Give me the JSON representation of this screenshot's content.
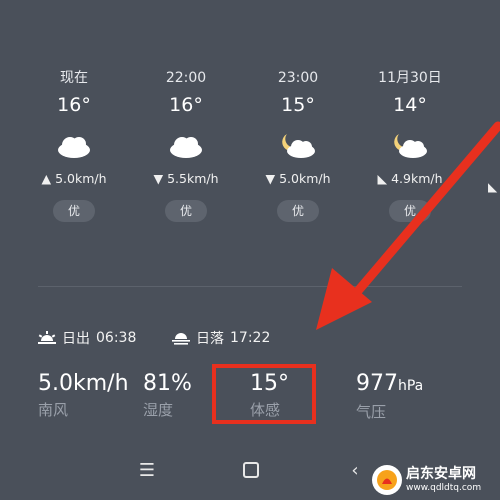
{
  "hourly": [
    {
      "time": "现在",
      "temp": "16°",
      "weather_icon": "cloudy-icon",
      "wind": "5.0km/h",
      "wind_dir_icon": "wind-arrow-up-icon",
      "aqi": "优"
    },
    {
      "time": "22:00",
      "temp": "16°",
      "weather_icon": "cloudy-icon",
      "wind": "5.5km/h",
      "wind_dir_icon": "wind-arrow-down-icon",
      "aqi": "优"
    },
    {
      "time": "23:00",
      "temp": "15°",
      "weather_icon": "partly-cloudy-night-icon",
      "wind": "5.0km/h",
      "wind_dir_icon": "wind-arrow-down-icon",
      "aqi": "优"
    },
    {
      "time": "11月30日",
      "temp": "14°",
      "weather_icon": "partly-cloudy-night-icon",
      "wind": "4.9km/h",
      "wind_dir_icon": "wind-arrow-down-left-icon",
      "aqi": "优"
    }
  ],
  "sun": {
    "sunrise_label": "日出",
    "sunrise_time": "06:38",
    "sunset_label": "日落",
    "sunset_time": "17:22"
  },
  "stats": {
    "wind_value": "5.0km/h",
    "wind_label": "南风",
    "humidity_value": "81%",
    "humidity_label": "湿度",
    "feels_value": "15°",
    "feels_label": "体感",
    "pressure_value": "977",
    "pressure_unit": "hPa",
    "pressure_label": "气压"
  },
  "watermark": {
    "title": "启东安卓网",
    "url": "www.qdldtq.com"
  },
  "colors": {
    "background": "#4a505a",
    "annotation_red": "#e8301e",
    "label_gray": "#9aa0aa"
  }
}
